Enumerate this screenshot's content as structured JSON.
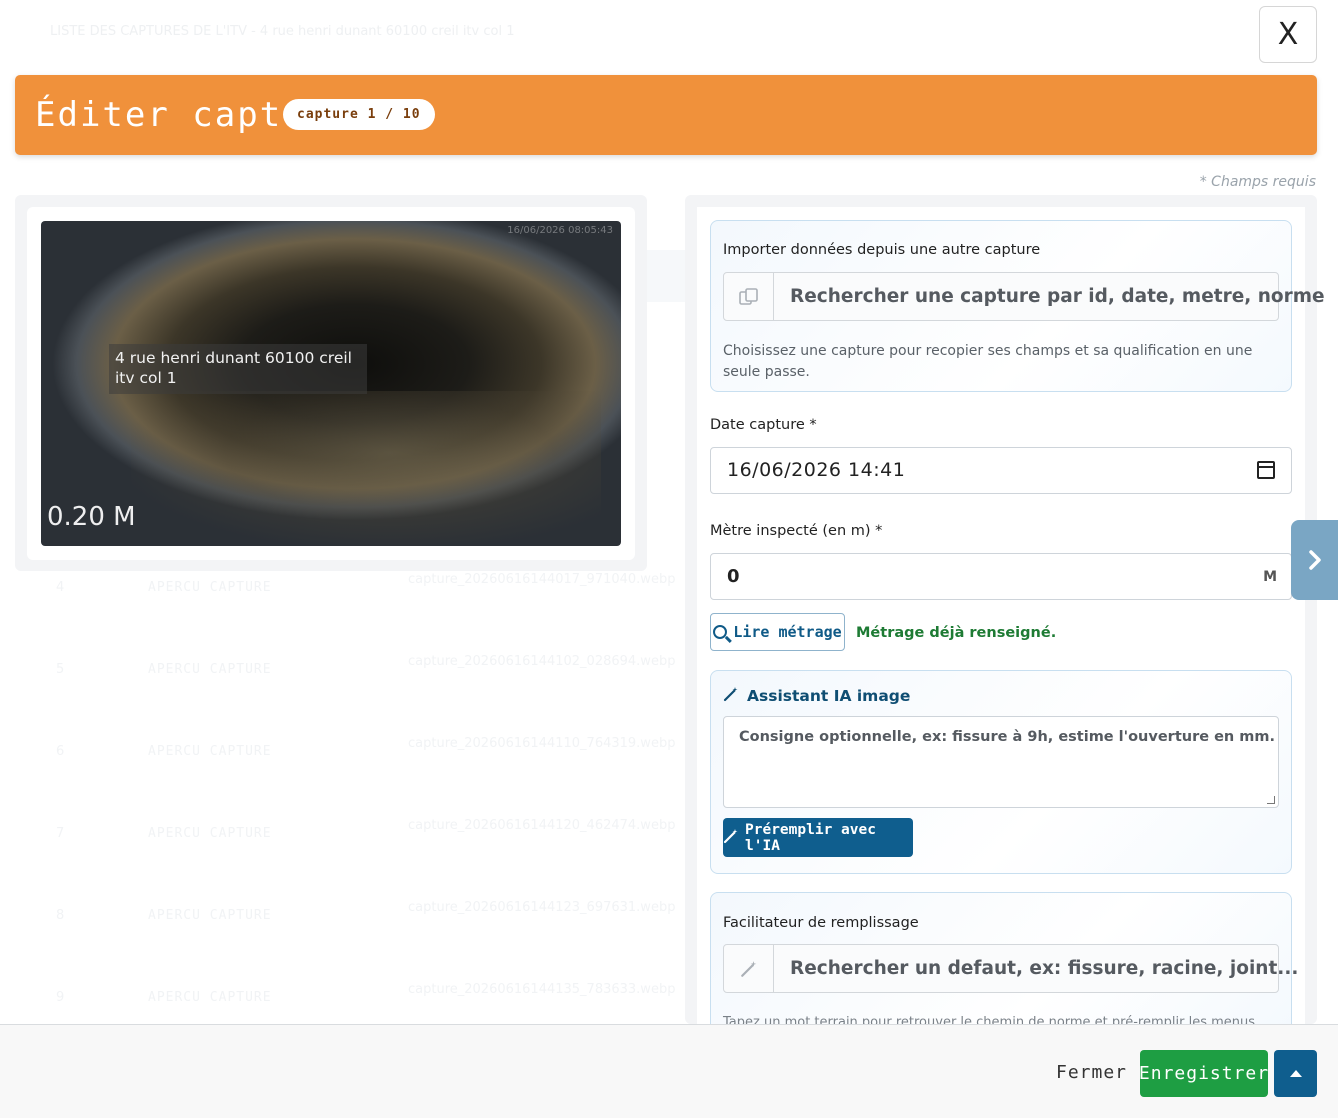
{
  "background": {
    "top_line": "LISTE DES CAPTURES DE L'ITV - 4 rue henri dunant 60100 creil itv col 1",
    "rows": [
      {
        "num": "4",
        "title": "APERCU CAPTURE",
        "file": "capture_20260616144017_971040.webp"
      },
      {
        "num": "5",
        "title": "APERCU CAPTURE",
        "file": "capture_20260616144102_028694.webp"
      },
      {
        "num": "6",
        "title": "APERCU CAPTURE",
        "file": "capture_20260616144110_764319.webp"
      },
      {
        "num": "7",
        "title": "APERCU CAPTURE",
        "file": "capture_20260616144120_462474.webp"
      },
      {
        "num": "8",
        "title": "APERCU CAPTURE",
        "file": "capture_20260616144123_697631.webp"
      },
      {
        "num": "9",
        "title": "APERCU CAPTURE",
        "file": "capture_20260616144135_783633.webp"
      }
    ]
  },
  "close_label": "X",
  "header": {
    "title": "Éditer capture",
    "badge": "capture 1 / 10"
  },
  "required_note": "* Champs requis",
  "capture_image": {
    "timestamp": "16/06/2026 08:05:43",
    "overlay_line1": "4 rue henri dunant 60100 creil",
    "overlay_line2": "itv col 1",
    "meter": "0.20 M"
  },
  "import_box": {
    "label": "Importer données depuis une autre capture",
    "placeholder": "Rechercher une capture par id, date, metre, norme",
    "help": "Choisissez une capture pour recopier ses champs et sa qualification en une seule passe.",
    "icon": "copy-icon"
  },
  "date_field": {
    "label": "Date capture *",
    "value": "16/06/2026  14:41",
    "icon": "calendar-icon"
  },
  "meter_field": {
    "label": "Mètre inspecté (en m) *",
    "value": "0",
    "unit": "M"
  },
  "read_button": "Lire métrage",
  "read_status": "Métrage déjà renseigné.",
  "ia_box": {
    "title": "Assistant IA image",
    "placeholder": "Consigne optionnelle, ex: fissure à 9h, estime l'ouverture en mm.",
    "button": "Préremplir avec l'IA",
    "icon": "magic-wand-icon"
  },
  "helper_box": {
    "label": "Facilitateur de remplissage",
    "placeholder": "Rechercher un defaut, ex: fissure, racine, joint...",
    "help": "Tapez un mot terrain pour retrouver le chemin de norme et pré-remplir les menus.",
    "icon": "magic-wand-icon"
  },
  "footer": {
    "close": "Fermer",
    "save": "Enregistrer"
  },
  "colors": {
    "header": "#f0913b",
    "primary": "#0f5e8e",
    "success": "#1e9e43"
  }
}
